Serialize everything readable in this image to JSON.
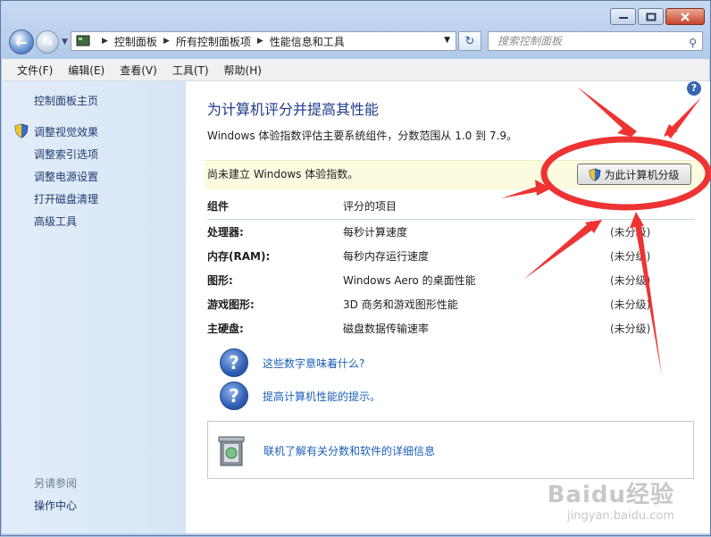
{
  "nav": {
    "back": "←",
    "forward": "→",
    "address_crumbs": [
      "控制面板",
      "所有控制面板项",
      "性能信息和工具"
    ],
    "search_placeholder": "搜索控制面板"
  },
  "menu": [
    "文件(F)",
    "编辑(E)",
    "查看(V)",
    "工具(T)",
    "帮助(H)"
  ],
  "sidebar": {
    "home": "控制面板主页",
    "links": [
      "调整视觉效果",
      "调整索引选项",
      "调整电源设置",
      "打开磁盘清理",
      "高级工具"
    ],
    "see_also_title": "另请参阅",
    "see_also": [
      "操作中心"
    ]
  },
  "main": {
    "title": "为计算机评分并提高其性能",
    "description": "Windows 体验指数评估主要系统组件，分数范围从 1.0 到 7.9。",
    "notice": "尚未建立 Windows 体验指数。",
    "rate_button": "为此计算机分级",
    "table": {
      "headers": [
        "组件",
        "评分的项目"
      ],
      "rows": [
        {
          "component": "处理器:",
          "item": "每秒计算速度",
          "score": "(未分级)"
        },
        {
          "component": "内存(RAM):",
          "item": "每秒内存运行速度",
          "score": "(未分级)"
        },
        {
          "component": "图形:",
          "item": "Windows Aero 的桌面性能",
          "score": "(未分级)"
        },
        {
          "component": "游戏图形:",
          "item": "3D 商务和游戏图形性能",
          "score": "(未分级)"
        },
        {
          "component": "主硬盘:",
          "item": "磁盘数据传输速率",
          "score": "(未分级)"
        }
      ]
    },
    "links": [
      "这些数字意味着什么?",
      "提高计算机性能的提示。"
    ],
    "info_link": "联机了解有关分数和软件的详细信息"
  },
  "watermark": {
    "line1": "Baidu经验",
    "line2": "jingyan.baidu.com"
  },
  "colors": {
    "link": "#1c5fb8",
    "title": "#1e3b8b",
    "annotation": "#ee3333"
  }
}
